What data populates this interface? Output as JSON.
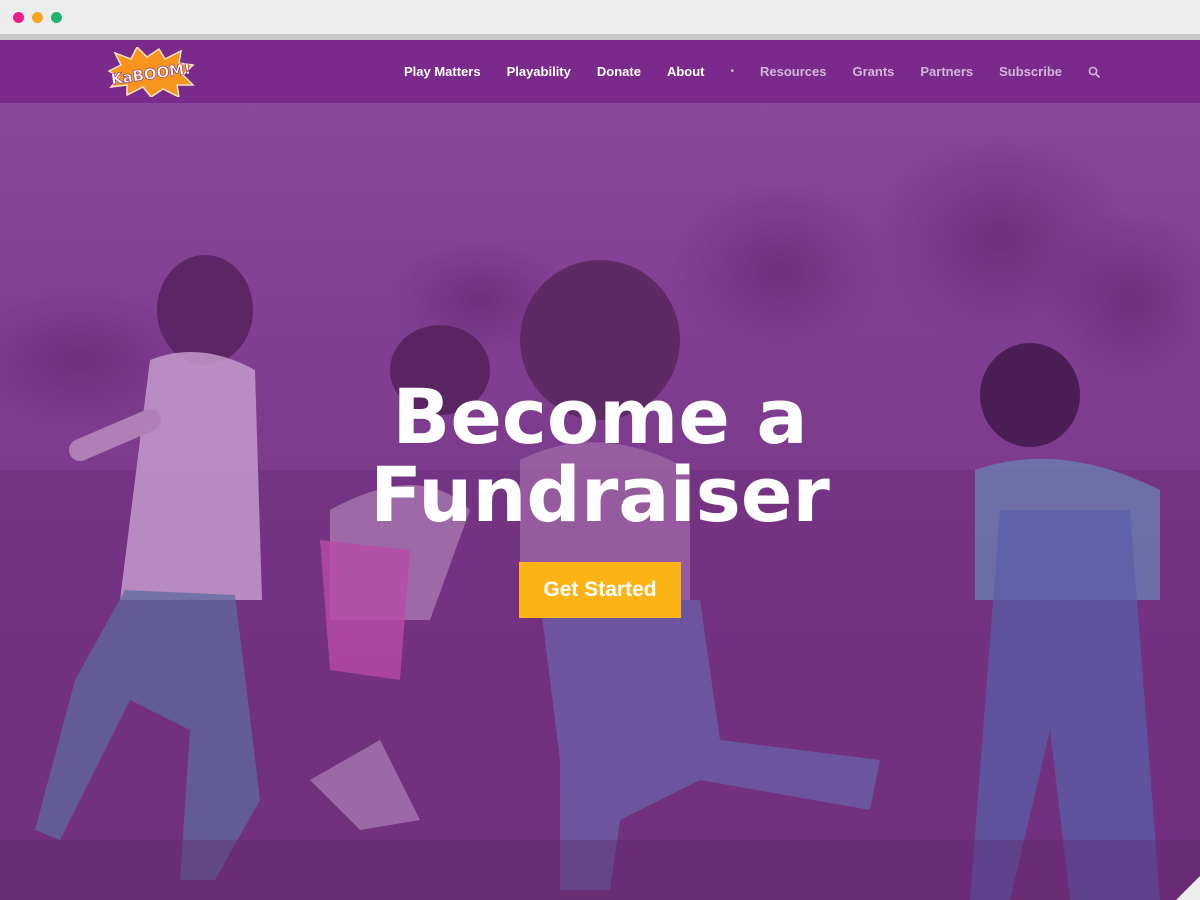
{
  "browser": {
    "controls": [
      "close",
      "minimize",
      "maximize"
    ]
  },
  "header": {
    "logo_icon": "kaboom-logo-icon",
    "logo_text": "KaBOOM!",
    "nav": {
      "items": [
        {
          "label": "Play Matters",
          "style": "primary"
        },
        {
          "label": "Playability",
          "style": "primary"
        },
        {
          "label": "Donate",
          "style": "primary"
        },
        {
          "label": "About",
          "style": "primary"
        },
        {
          "label": "Resources",
          "style": "secondary"
        },
        {
          "label": "Grants",
          "style": "secondary"
        },
        {
          "label": "Partners",
          "style": "secondary"
        },
        {
          "label": "Subscribe",
          "style": "secondary"
        }
      ],
      "separator": "•",
      "search_icon": "search-icon"
    }
  },
  "hero": {
    "title_line1": "Become a",
    "title_line2": "Fundraiser",
    "cta_label": "Get Started",
    "background_description_icon": "children-playing-photo"
  },
  "colors": {
    "header_bg": "#7a2a8a",
    "overlay": "#7d3a8c",
    "cta_bg": "#fbb316",
    "logo_orange": "#f7941d",
    "nav_muted": "#d4b6dc"
  }
}
